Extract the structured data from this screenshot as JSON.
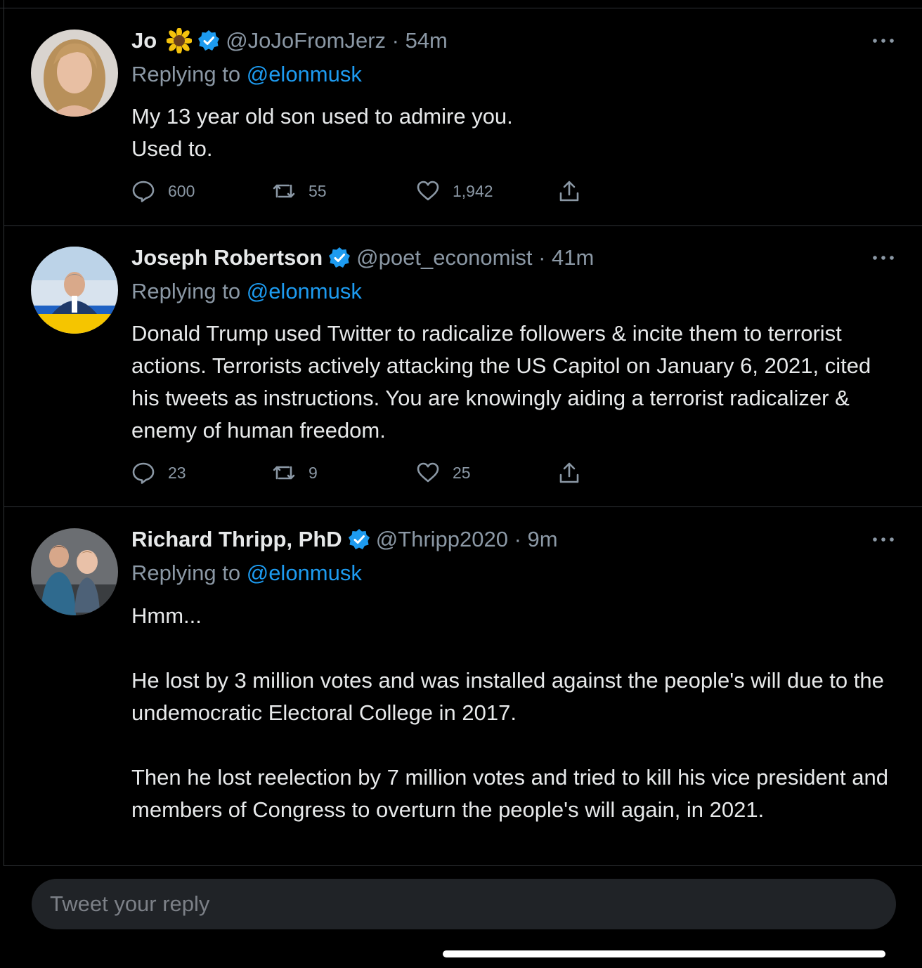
{
  "tweets": [
    {
      "name": "Jo",
      "handle_time": "@JoJoFromJerz · 54m",
      "replying_prefix": "Replying to ",
      "replying_to": "@elonmusk",
      "text": "My 13 year old son used to admire you.\nUsed to.",
      "replies": "600",
      "retweets": "55",
      "likes": "1,942",
      "has_emoji": true,
      "emoji_icon": "sunflower-icon"
    },
    {
      "name": "Joseph Robertson",
      "handle_time": "@poet_economist · 41m",
      "replying_prefix": "Replying to ",
      "replying_to": "@elonmusk",
      "text": "Donald Trump used Twitter to radicalize followers & incite them to terrorist actions. Terrorists actively attacking the US Capitol on January 6, 2021, cited his tweets as instructions. You are knowingly aiding a terrorist radicalizer & enemy of human freedom.",
      "replies": "23",
      "retweets": "9",
      "likes": "25"
    },
    {
      "name": "Richard Thripp, PhD",
      "handle_time": "@Thripp2020 · 9m",
      "replying_prefix": "Replying to ",
      "replying_to": "@elonmusk",
      "text": "Hmm...\n\nHe lost by 3 million votes and was installed against the people's will due to the undemocratic Electoral College in 2017.\n\nThen he lost reelection by 7 million votes and tried to kill his vice president and members of Congress to overturn the people's will again, in 2021."
    }
  ],
  "composer": {
    "placeholder": "Tweet your reply"
  },
  "colors": {
    "accent": "#1d9bf0",
    "muted": "#8b98a5",
    "background": "#000000"
  }
}
